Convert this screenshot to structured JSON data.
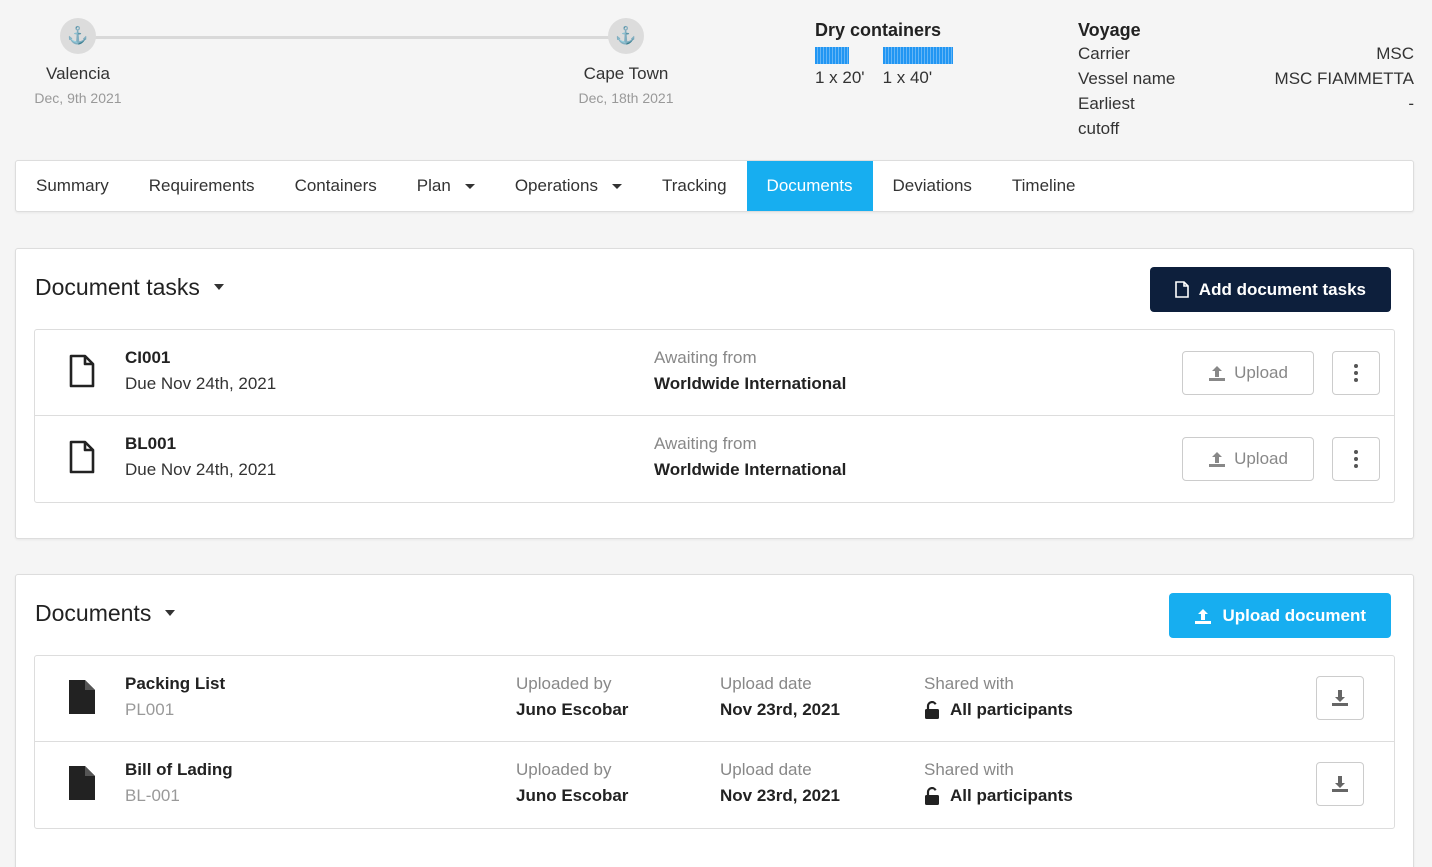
{
  "route": {
    "origin": {
      "name": "Valencia",
      "date": "Dec, 9th 2021",
      "icon": "anchor-icon"
    },
    "destination": {
      "name": "Cape Town",
      "date": "Dec, 18th 2021",
      "icon": "anchor-icon"
    }
  },
  "containers": {
    "title": "Dry containers",
    "items": [
      {
        "label": "1 x 20'",
        "count": 1,
        "size": "20'"
      },
      {
        "label": "1 x 40'",
        "count": 1,
        "size": "40'"
      }
    ],
    "bar_color": "#2196f3"
  },
  "voyage": {
    "title": "Voyage",
    "rows": [
      {
        "key": "Carrier",
        "value": "MSC"
      },
      {
        "key": "Vessel name",
        "value": "MSC FIAMMETTA"
      },
      {
        "key": "Earliest cutoff",
        "value": "-"
      }
    ]
  },
  "tabs": [
    {
      "label": "Summary",
      "dropdown": false,
      "active": false
    },
    {
      "label": "Requirements",
      "dropdown": false,
      "active": false
    },
    {
      "label": "Containers",
      "dropdown": false,
      "active": false
    },
    {
      "label": "Plan",
      "dropdown": true,
      "active": false
    },
    {
      "label": "Operations",
      "dropdown": true,
      "active": false
    },
    {
      "label": "Tracking",
      "dropdown": false,
      "active": false
    },
    {
      "label": "Documents",
      "dropdown": false,
      "active": true
    },
    {
      "label": "Deviations",
      "dropdown": false,
      "active": false
    },
    {
      "label": "Timeline",
      "dropdown": false,
      "active": false
    }
  ],
  "document_tasks": {
    "title": "Document tasks",
    "add_button": "Add document tasks",
    "items": [
      {
        "name": "CI001",
        "due": "Due Nov 24th, 2021",
        "awaiting_label": "Awaiting from",
        "awaiting_from": "Worldwide International",
        "upload_label": "Upload"
      },
      {
        "name": "BL001",
        "due": "Due Nov 24th, 2021",
        "awaiting_label": "Awaiting from",
        "awaiting_from": "Worldwide International",
        "upload_label": "Upload"
      }
    ]
  },
  "documents": {
    "title": "Documents",
    "upload_button": "Upload document",
    "items": [
      {
        "name": "Packing List",
        "code": "PL001",
        "uploaded_by_label": "Uploaded by",
        "uploaded_by": "Juno Escobar",
        "date_label": "Upload date",
        "date": "Nov 23rd, 2021",
        "shared_label": "Shared with",
        "shared_with": "All participants"
      },
      {
        "name": "Bill of Lading",
        "code": "BL-001",
        "uploaded_by_label": "Uploaded by",
        "uploaded_by": "Juno Escobar",
        "date_label": "Upload date",
        "date": "Nov 23rd, 2021",
        "shared_label": "Shared with",
        "shared_with": "All participants"
      }
    ]
  },
  "colors": {
    "accent": "#17aef0",
    "dark_button": "#0d1f3c"
  }
}
